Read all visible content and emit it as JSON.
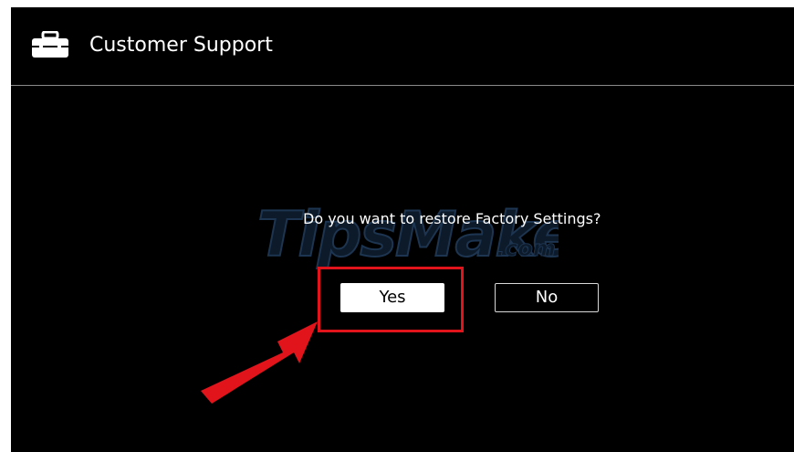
{
  "header": {
    "icon": "toolbox-icon",
    "title": "Customer Support"
  },
  "dialog": {
    "question": "Do you want to restore Factory Settings?",
    "yes_label": "Yes",
    "no_label": "No"
  },
  "watermark": {
    "text": "TipsMake",
    "suffix": ".com"
  },
  "colors": {
    "background": "#000000",
    "text": "#ffffff",
    "highlight": "#e0141a",
    "arrow": "#e0141a",
    "divider": "#8a8a8a"
  }
}
